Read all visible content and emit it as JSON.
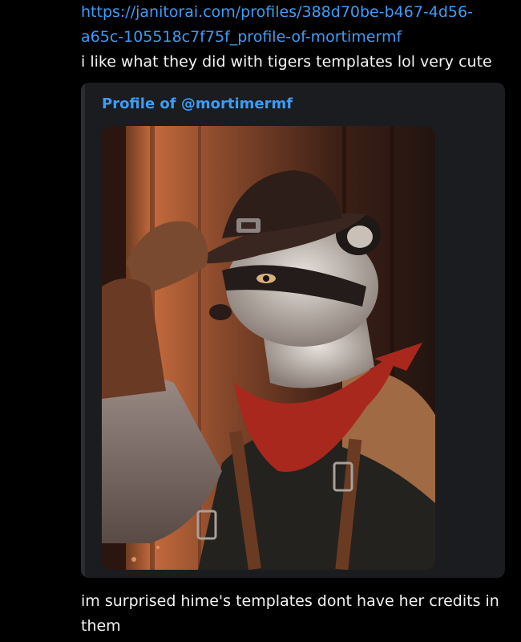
{
  "message1": {
    "link_text": "https://janitorai.com/profiles/388d70be-b467-4d56-a65c-105518c7f75f_profile-of-mortimermf",
    "text": "i like what they did with tigers templates lol very cute"
  },
  "embed": {
    "title": "Profile of @mortimermf",
    "accent_color": "#2b2d31",
    "link_color": "#3e9cf5"
  },
  "message2": {
    "text": "im surprised hime's templates dont have her credits in them"
  }
}
